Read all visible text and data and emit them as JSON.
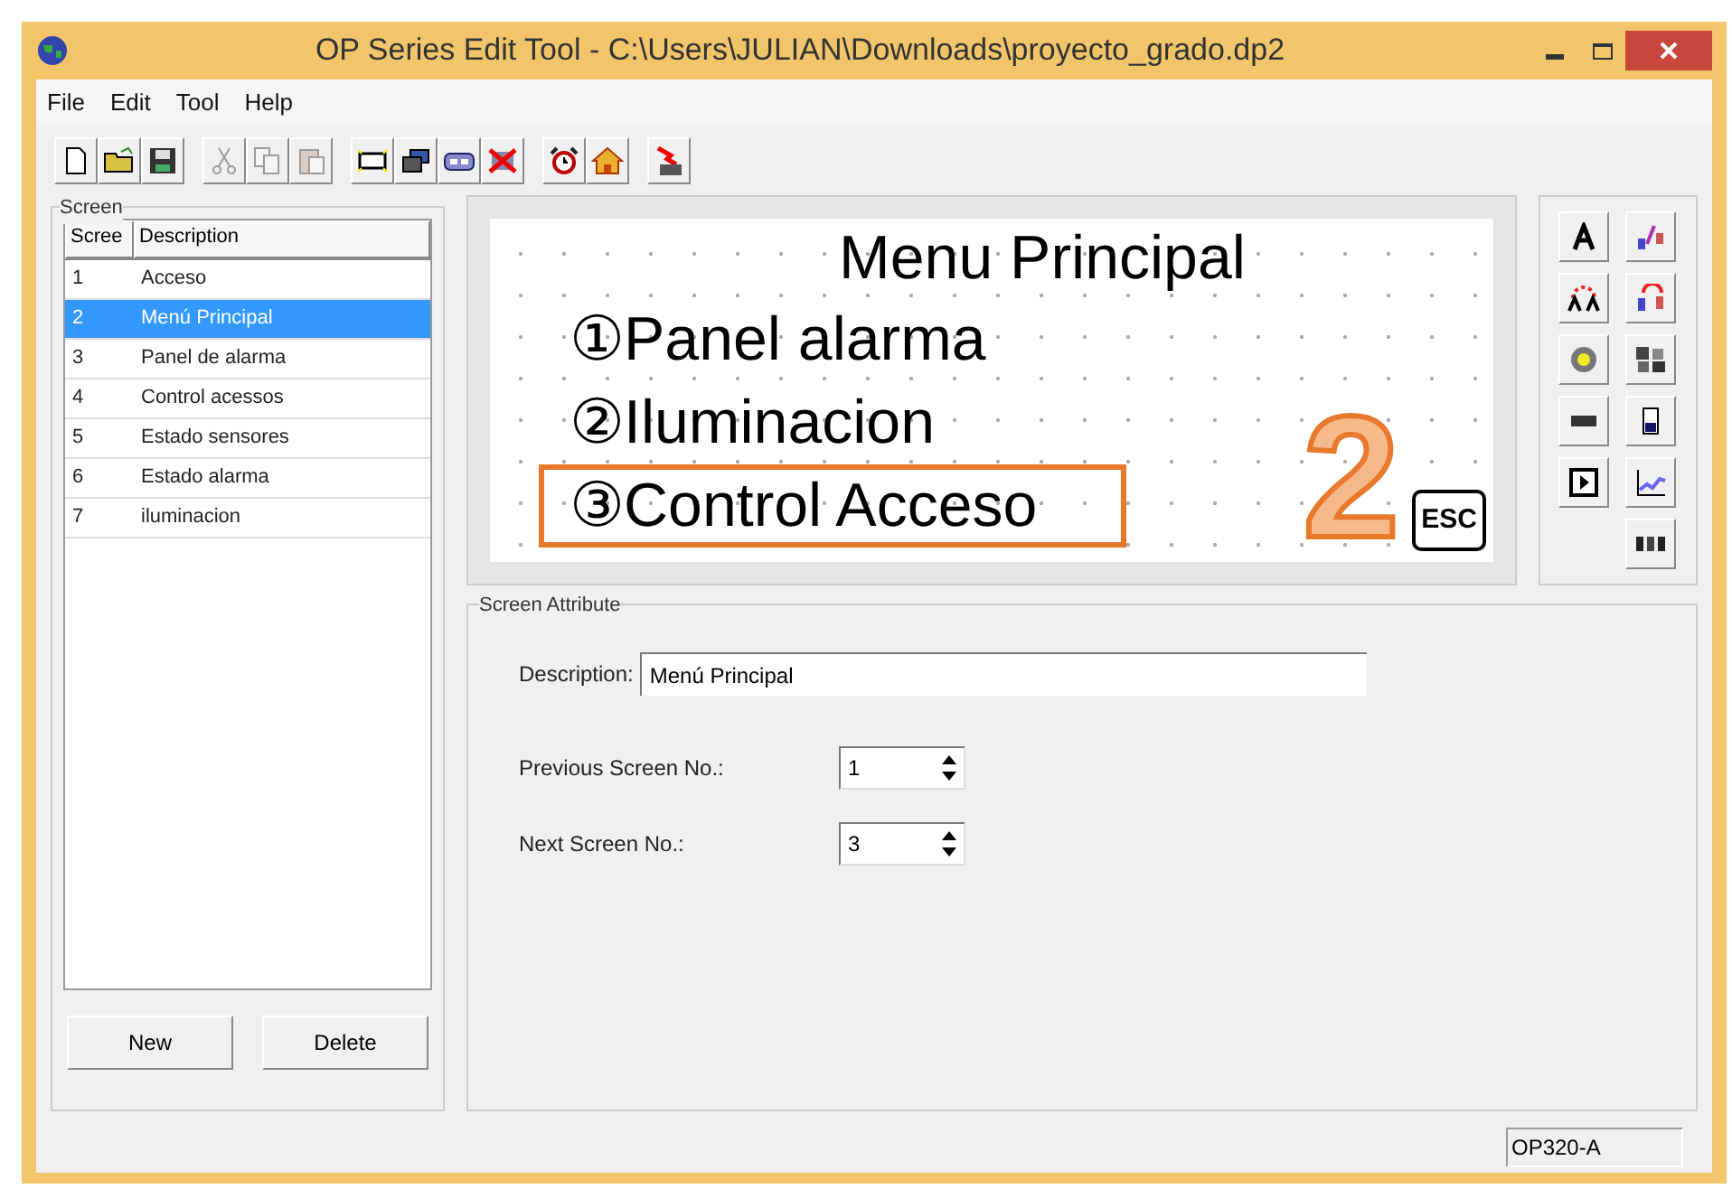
{
  "window": {
    "title": "OP Series Edit Tool - C:\\Users\\JULIAN\\Downloads\\proyecto_grado.dp2"
  },
  "menu": [
    "File",
    "Edit",
    "Tool",
    "Help"
  ],
  "toolbar": [
    [
      {
        "kind": "new",
        "disabled": false
      },
      {
        "kind": "open",
        "disabled": false
      },
      {
        "kind": "save",
        "disabled": false
      }
    ],
    [
      {
        "kind": "cut",
        "disabled": true
      },
      {
        "kind": "copy",
        "disabled": true
      },
      {
        "kind": "paste",
        "disabled": true
      }
    ],
    [
      {
        "kind": "screen",
        "disabled": false
      },
      {
        "kind": "screens",
        "disabled": false
      },
      {
        "kind": "link",
        "disabled": false
      },
      {
        "kind": "delete",
        "disabled": false
      }
    ],
    [
      {
        "kind": "alarm",
        "disabled": false
      },
      {
        "kind": "home",
        "disabled": false
      }
    ],
    [
      {
        "kind": "download",
        "disabled": false
      }
    ]
  ],
  "screen_list": {
    "title": "Screen",
    "columns": [
      "Scree",
      "Description"
    ],
    "rows": [
      {
        "no": "1",
        "description": "Acceso",
        "selected": false
      },
      {
        "no": "2",
        "description": "Menú Principal",
        "selected": true
      },
      {
        "no": "3",
        "description": "Panel de alarma",
        "selected": false
      },
      {
        "no": "4",
        "description": "Control acessos",
        "selected": false
      },
      {
        "no": "5",
        "description": "Estado sensores",
        "selected": false
      },
      {
        "no": "6",
        "description": "Estado alarma",
        "selected": false
      },
      {
        "no": "7",
        "description": "iluminacion",
        "selected": false
      }
    ],
    "buttons": [
      "New",
      "Delete"
    ]
  },
  "canvas": {
    "title": "Menu Principal",
    "items": [
      {
        "marker": "①",
        "label": "Panel alarma",
        "highlighted": false
      },
      {
        "marker": "②",
        "label": "Iluminacion",
        "highlighted": false
      },
      {
        "marker": "③",
        "label": "Control Acceso",
        "highlighted": true
      }
    ],
    "annotation": "2",
    "key": "ESC"
  },
  "toolbox": [
    {
      "kind": "text"
    },
    {
      "kind": "bit-text"
    },
    {
      "kind": "bit-lamp"
    },
    {
      "kind": "word-lamp"
    },
    {
      "kind": "lamp"
    },
    {
      "kind": "image"
    },
    {
      "kind": "number"
    },
    {
      "kind": "bar"
    },
    {
      "kind": "button"
    },
    {
      "kind": "trend"
    },
    {
      "kind": "ascii"
    }
  ],
  "attributes": {
    "title": "Screen Attribute",
    "description": {
      "label": "Description:",
      "value": "Menú Principal"
    },
    "previous": {
      "label": "Previous Screen No.:",
      "value": "1"
    },
    "next": {
      "label": "Next Screen No.:",
      "value": "3"
    }
  },
  "status_bar": {
    "model": "OP320-A"
  }
}
